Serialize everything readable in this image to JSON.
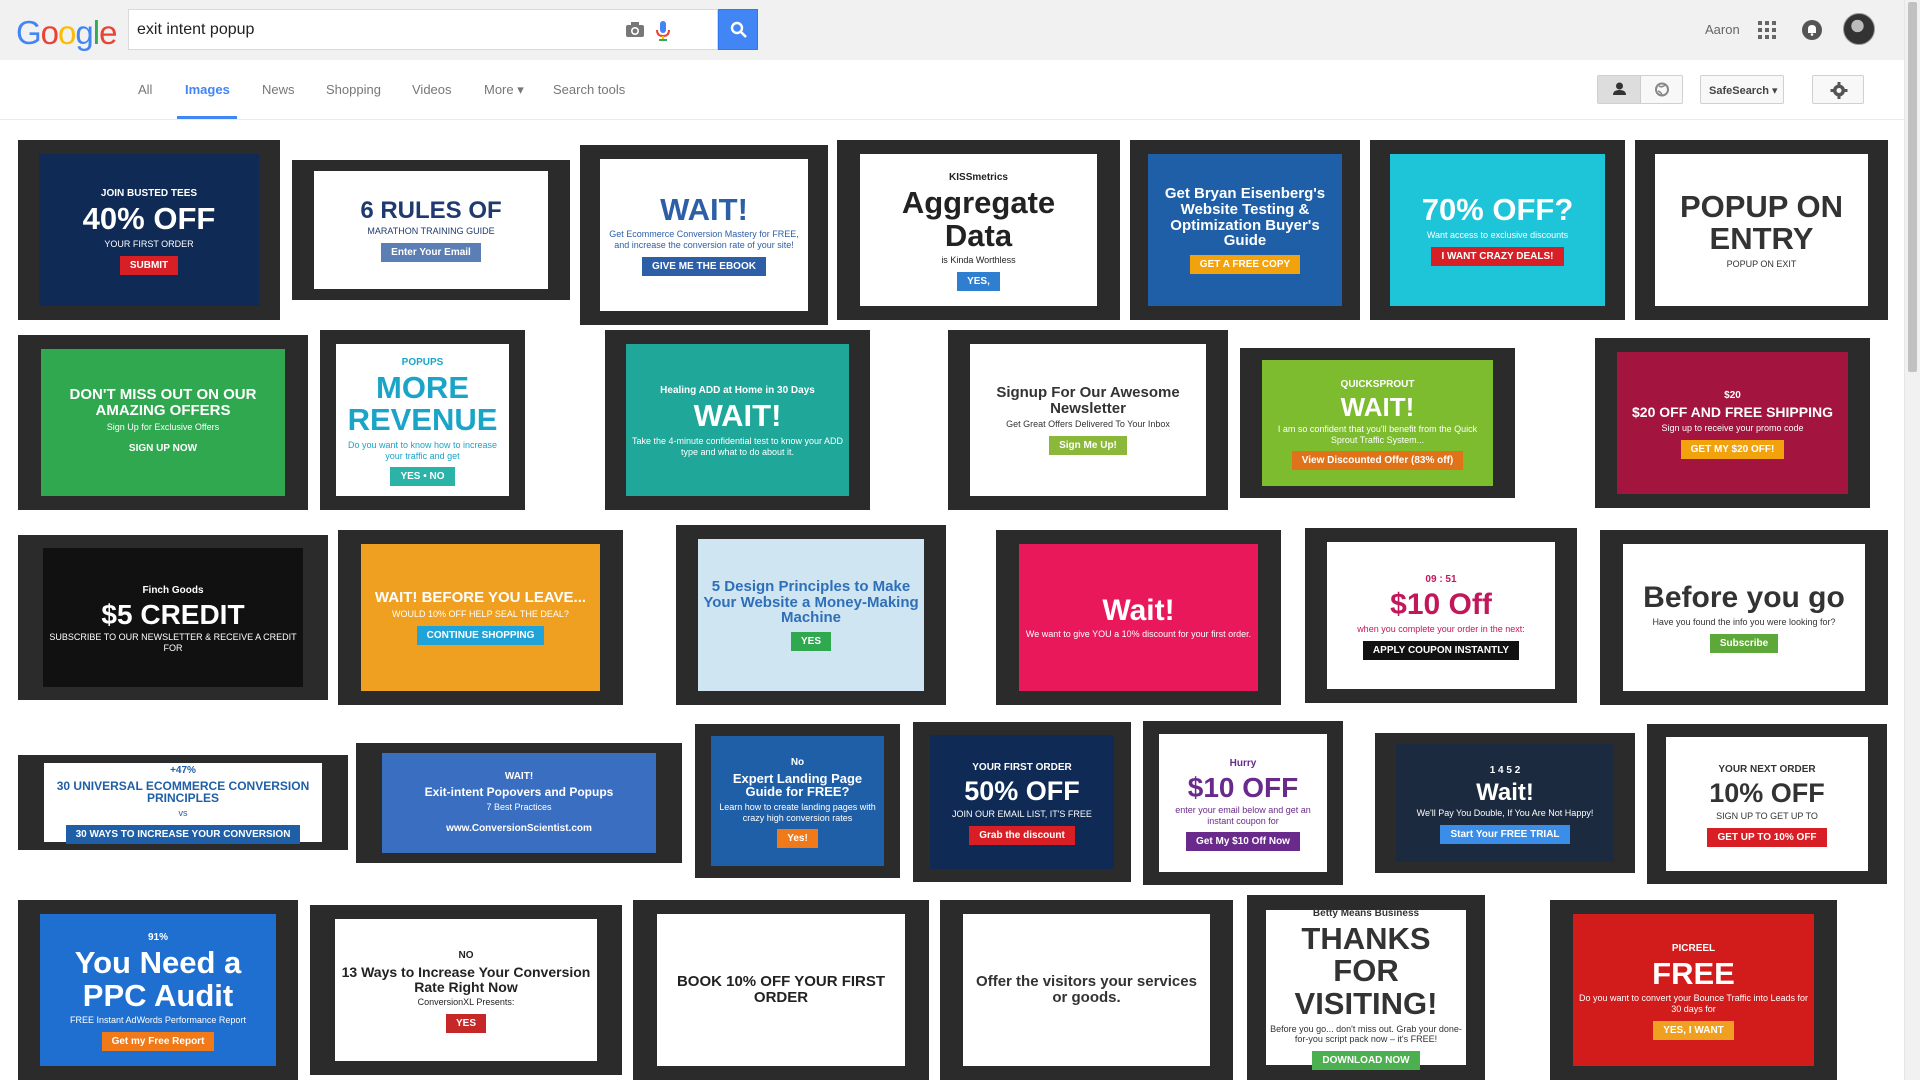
{
  "header": {
    "logo": [
      "G",
      "o",
      "o",
      "g",
      "l",
      "e"
    ],
    "logo_colors": [
      "#4285f4",
      "#ea4335",
      "#fbbc05",
      "#4285f4",
      "#34a853",
      "#ea4335"
    ],
    "search_value": "exit intent popup",
    "user_name": "Aaron",
    "accent": "#4285f4"
  },
  "nav": {
    "tabs": [
      "All",
      "Images",
      "News",
      "Shopping",
      "Videos",
      "More ▾",
      "Search tools"
    ],
    "active_tab": "Images",
    "safesearch_label": "SafeSearch ▾"
  },
  "results": [
    {
      "head": "40% OFF",
      "sub": "YOUR FIRST ORDER",
      "btn": "SUBMIT",
      "top": "JOIN BUSTED TEES",
      "bg": "#0e2a55",
      "fg": "#ffffff",
      "btnbg": "#d81f26"
    },
    {
      "head": "6 RULES OF",
      "sub": "MARATHON TRAINING GUIDE",
      "btn": "Enter Your Email",
      "top": "",
      "bg": "#ffffff",
      "fg": "#1f3a6e",
      "btnbg": "#5b7fb5"
    },
    {
      "head": "WAIT!",
      "sub": "Get Ecommerce Conversion Mastery for FREE, and increase the conversion rate of your site!",
      "btn": "GIVE ME THE EBOOK",
      "top": "",
      "bg": "#ffffff",
      "fg": "#2d5fa8",
      "btnbg": "#2d5fa8"
    },
    {
      "head": "Aggregate Data",
      "sub": "is Kinda Worthless",
      "btn": "YES,",
      "top": "KISSmetrics",
      "bg": "#ffffff",
      "fg": "#222222",
      "btnbg": "#2f7fd0"
    },
    {
      "head": "Get Bryan Eisenberg's Website Testing & Optimization Buyer's Guide",
      "sub": "",
      "btn": "GET A FREE COPY",
      "top": "",
      "bg": "#1f5fa8",
      "fg": "#ffffff",
      "btnbg": "#f2a20c"
    },
    {
      "head": "70% OFF?",
      "sub": "Want access to exclusive discounts",
      "btn": "I WANT CRAZY DEALS!",
      "top": "",
      "bg": "#1ec4d8",
      "fg": "#ffffff",
      "btnbg": "#d81f26"
    },
    {
      "head": "POPUP ON ENTRY",
      "sub": "POPUP ON EXIT",
      "btn": "",
      "top": "",
      "bg": "#ffffff",
      "fg": "#333333",
      "btnbg": "#e53935"
    },
    {
      "head": "DON'T MISS OUT ON OUR AMAZING OFFERS",
      "sub": "Sign Up for Exclusive Offers",
      "btn": "SIGN UP NOW",
      "top": "",
      "bg": "#2fa84f",
      "fg": "#ffffff",
      "btnbg": "#2fa84f"
    },
    {
      "head": "MORE REVENUE",
      "sub": "Do you want to know how to increase your traffic and get",
      "btn": "YES • NO",
      "top": "POPUPS",
      "bg": "#ffffff",
      "fg": "#1aa5c8",
      "btnbg": "#2bb3a8"
    },
    {
      "head": "WAIT!",
      "sub": "Take the 4-minute confidential test to know your ADD type and what to do about it.",
      "btn": "",
      "top": "Healing ADD at Home in 30 Days",
      "bg": "#1fa79a",
      "fg": "#ffffff",
      "btnbg": "#f2a20c"
    },
    {
      "head": "Signup For Our Awesome Newsletter",
      "sub": "Get Great Offers Delivered To Your Inbox",
      "btn": "Sign Me Up!",
      "top": "",
      "bg": "#ffffff",
      "fg": "#333333",
      "btnbg": "#8bb83a"
    },
    {
      "head": "WAIT!",
      "sub": "I am so confident that you'll benefit from the Quick Sprout Traffic System...",
      "btn": "View Discounted Offer (83% off)",
      "top": "QUICKSPROUT",
      "bg": "#7dbb2f",
      "fg": "#ffffff",
      "btnbg": "#e0731a"
    },
    {
      "head": "$20 OFF AND FREE SHIPPING",
      "sub": "Sign up to receive your promo code",
      "btn": "GET MY $20 OFF!",
      "top": "$20",
      "bg": "#a3143f",
      "fg": "#ffffff",
      "btnbg": "#f2a20c"
    },
    {
      "head": "$5 CREDIT",
      "sub": "SUBSCRIBE TO OUR NEWSLETTER & RECEIVE A CREDIT FOR",
      "btn": "",
      "top": "Finch Goods",
      "bg": "#111111",
      "fg": "#ffffff",
      "btnbg": "#111111"
    },
    {
      "head": "WAIT! BEFORE YOU LEAVE...",
      "sub": "WOULD 10% OFF HELP SEAL THE DEAL?",
      "btn": "CONTINUE SHOPPING",
      "top": "",
      "bg": "#f0a020",
      "fg": "#ffffff",
      "btnbg": "#1fa3d8"
    },
    {
      "head": "5 Design Principles to Make Your Website a Money-Making Machine",
      "sub": "",
      "btn": "YES",
      "top": "",
      "bg": "#cfe6f2",
      "fg": "#2f6fb8",
      "btnbg": "#2fa84f"
    },
    {
      "head": "Wait!",
      "sub": "We want to give YOU a 10% discount for your first order.",
      "btn": "",
      "top": "",
      "bg": "#e8185a",
      "fg": "#ffffff",
      "btnbg": "#ffffff"
    },
    {
      "head": "$10 Off",
      "sub": "when you complete your order in the next:",
      "btn": "APPLY COUPON INSTANTLY",
      "top": "09 : 51",
      "bg": "#ffffff",
      "fg": "#c2185b",
      "btnbg": "#111111"
    },
    {
      "head": "Before you go",
      "sub": "Have you found the info you were looking for?",
      "btn": "Subscribe",
      "top": "",
      "bg": "#ffffff",
      "fg": "#333333",
      "btnbg": "#5ea83a"
    },
    {
      "head": "30 UNIVERSAL ECOMMERCE CONVERSION PRINCIPLES",
      "sub": "vs",
      "btn": "30 WAYS TO INCREASE YOUR CONVERSION",
      "top": "+47%",
      "bg": "#ffffff",
      "fg": "#1f5fa8",
      "btnbg": "#1f5fa8"
    },
    {
      "head": "Exit-intent Popovers and Popups",
      "sub": "7 Best Practices",
      "btn": "www.ConversionScientist.com",
      "top": "WAIT!",
      "bg": "#3a6ec0",
      "fg": "#ffffff",
      "btnbg": "#3a6ec0"
    },
    {
      "head": "Expert Landing Page Guide for FREE?",
      "sub": "Learn how to create landing pages with crazy high conversion rates",
      "btn": "Yes!",
      "top": "No",
      "bg": "#1f5fa8",
      "fg": "#ffffff",
      "btnbg": "#f07a1a"
    },
    {
      "head": "50% OFF",
      "sub": "JOIN OUR EMAIL LIST, IT'S FREE",
      "btn": "Grab the discount",
      "top": "YOUR FIRST ORDER",
      "bg": "#0e2a55",
      "fg": "#ffffff",
      "btnbg": "#d81f26"
    },
    {
      "head": "$10 OFF",
      "sub": "enter your email below and get an instant coupon for",
      "btn": "Get My $10 Off Now",
      "top": "Hurry",
      "bg": "#ffffff",
      "fg": "#6a2a8c",
      "btnbg": "#6a2a8c"
    },
    {
      "head": "Wait!",
      "sub": "We'll Pay You Double, If You Are Not Happy!",
      "btn": "Start Your FREE TRIAL",
      "top": "1 4 5 2",
      "bg": "#1b2a3e",
      "fg": "#ffffff",
      "btnbg": "#3a8ee8"
    },
    {
      "head": "10% OFF",
      "sub": "SIGN UP TO GET UP TO",
      "btn": "GET UP TO 10% OFF",
      "top": "YOUR NEXT ORDER",
      "bg": "#ffffff",
      "fg": "#333333",
      "btnbg": "#d81f26"
    },
    {
      "head": "You Need a PPC Audit",
      "sub": "FREE Instant AdWords Performance Report",
      "btn": "Get my Free Report",
      "top": "91%",
      "bg": "#1f6fd0",
      "fg": "#ffffff",
      "btnbg": "#f07a1a"
    },
    {
      "head": "13 Ways to Increase Your Conversion Rate Right Now",
      "sub": "ConversionXL Presents:",
      "btn": "YES",
      "top": "NO",
      "bg": "#ffffff",
      "fg": "#222222",
      "btnbg": "#c62828"
    },
    {
      "head": "BOOK 10% OFF YOUR FIRST ORDER",
      "sub": "",
      "btn": "",
      "top": "",
      "bg": "#ffffff",
      "fg": "#222222",
      "btnbg": "#222222"
    },
    {
      "head": "Offer the visitors your services or goods.",
      "sub": "",
      "btn": "",
      "top": "",
      "bg": "#ffffff",
      "fg": "#333333",
      "btnbg": "#1fa3d8"
    },
    {
      "head": "THANKS FOR VISITING!",
      "sub": "Before you go... don't miss out. Grab your done-for-you script pack now – it's FREE!",
      "btn": "DOWNLOAD NOW",
      "top": "Betty Means Business",
      "bg": "#ffffff",
      "fg": "#333333",
      "btnbg": "#4caf50"
    },
    {
      "head": "FREE",
      "sub": "Do you want to convert your Bounce Traffic into Leads for 30 days for",
      "btn": "YES, I WANT",
      "top": "PICREEL",
      "bg": "#d21c1c",
      "fg": "#ffffff",
      "btnbg": "#f0a020"
    }
  ]
}
